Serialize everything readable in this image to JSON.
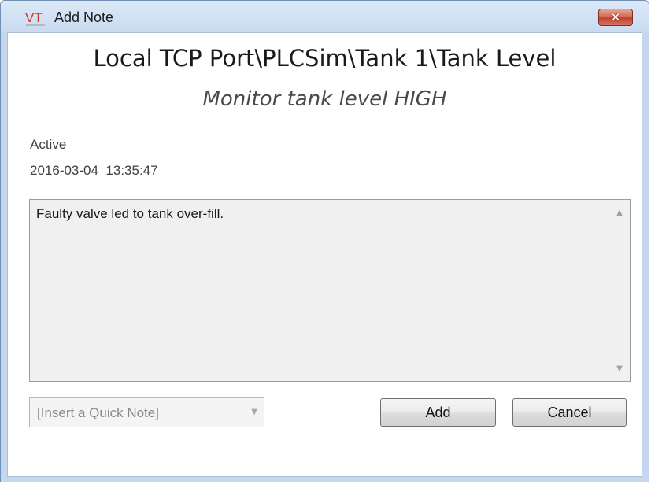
{
  "window": {
    "title": "Add Note",
    "app_icon_text": "VT",
    "close_symbol": "✕"
  },
  "header": {
    "path": "Local TCP Port\\PLCSim\\Tank 1\\Tank Level",
    "description": "Monitor tank level HIGH"
  },
  "alarm": {
    "status": "Active",
    "timestamp": "2016-03-04  13:35:47"
  },
  "note": {
    "text": "Faulty valve led to tank over-fill."
  },
  "quick_note": {
    "placeholder": "[Insert a Quick Note]"
  },
  "buttons": {
    "add_label": "Add",
    "cancel_label": "Cancel"
  },
  "colors": {
    "titlebar": "#c9dbf0",
    "close_button": "#c2402a",
    "icon_red": "#d8322c"
  }
}
